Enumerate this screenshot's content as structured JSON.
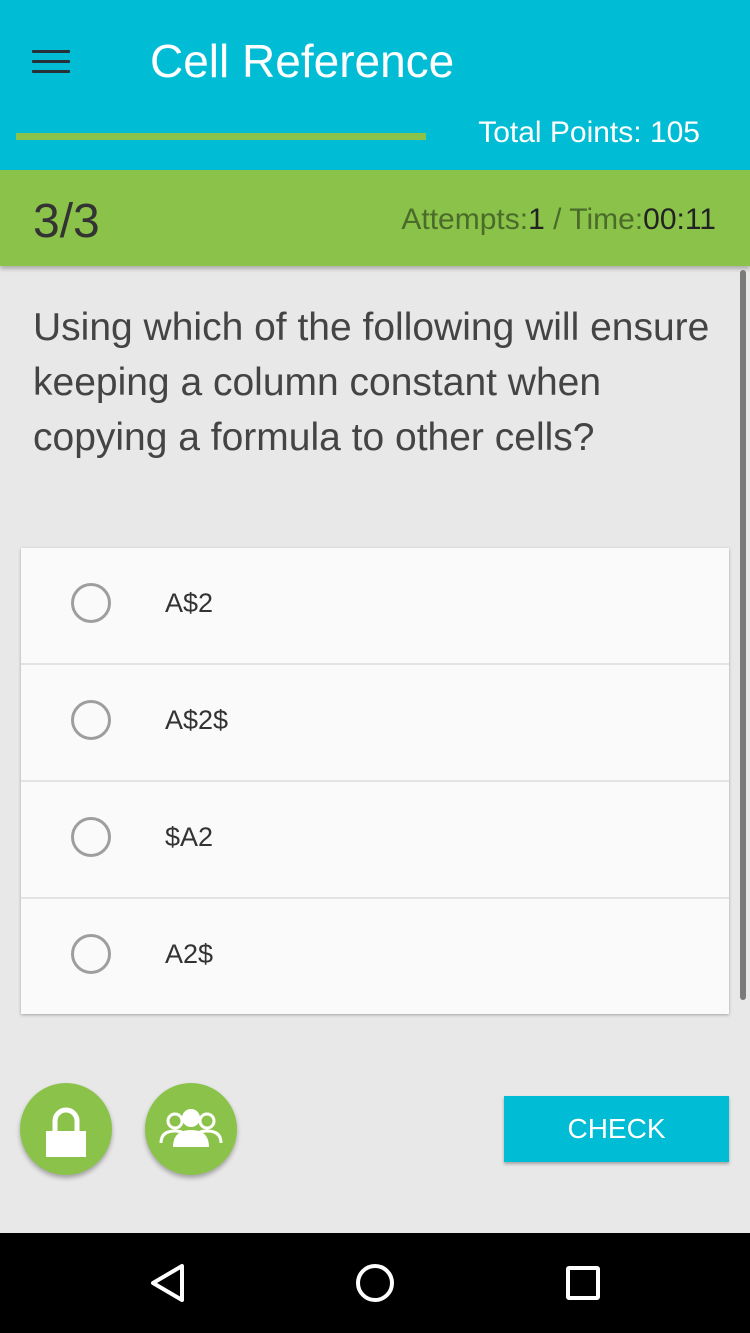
{
  "header": {
    "title": "Cell Reference",
    "total_points": "Total Points: 105",
    "progress_fraction": 1.0,
    "accent_color": "#00bcd4"
  },
  "status": {
    "counter": "3/3",
    "attempts_label": "Attempts:",
    "attempts_value": "1",
    "separator": " / ",
    "time_label": "Time:",
    "time_value": "00:11",
    "color": "#8bc34a"
  },
  "question": {
    "text": "Using which of the following will ensure keeping a column constant when copying a formula to other cells?"
  },
  "options": [
    {
      "label": "A$2"
    },
    {
      "label": "A$2$"
    },
    {
      "label": "$A2"
    },
    {
      "label": "A2$"
    }
  ],
  "actions": {
    "lock_icon": "lock-icon",
    "group_icon": "group-icon",
    "check_label": "CHECK"
  },
  "navbar": {
    "back_icon": "back-icon",
    "home_icon": "home-icon",
    "recents_icon": "recents-icon"
  }
}
